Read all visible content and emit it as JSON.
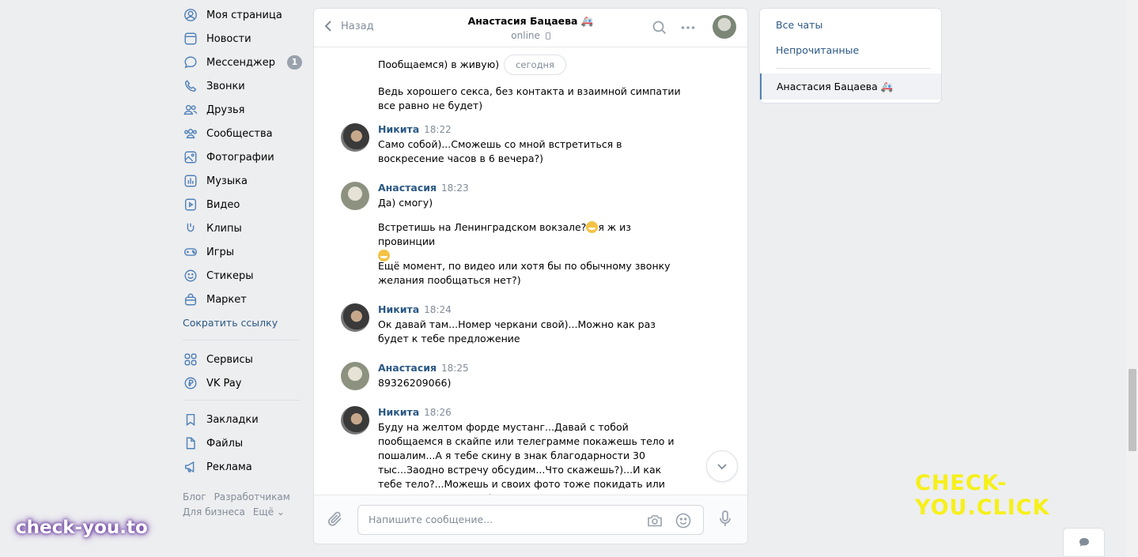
{
  "nav": {
    "items": [
      {
        "label": "Моя страница",
        "icon": "user-circle-icon"
      },
      {
        "label": "Новости",
        "icon": "news-icon"
      },
      {
        "label": "Мессенджер",
        "icon": "message-icon",
        "badge": "1"
      },
      {
        "label": "Звонки",
        "icon": "phone-icon"
      },
      {
        "label": "Друзья",
        "icon": "friends-icon"
      },
      {
        "label": "Сообщества",
        "icon": "communities-icon"
      },
      {
        "label": "Фотографии",
        "icon": "photo-icon"
      },
      {
        "label": "Музыка",
        "icon": "music-icon"
      },
      {
        "label": "Видео",
        "icon": "video-icon"
      },
      {
        "label": "Клипы",
        "icon": "clips-icon"
      },
      {
        "label": "Игры",
        "icon": "gamepad-icon"
      },
      {
        "label": "Стикеры",
        "icon": "sticker-icon"
      },
      {
        "label": "Маркет",
        "icon": "market-bag-icon"
      }
    ],
    "shorten_link": "Сократить ссылку",
    "services": "Сервисы",
    "vkpay": "VK Pay",
    "bookmarks": "Закладки",
    "files": "Файлы",
    "ads": "Реклама",
    "footer": {
      "blog": "Блог",
      "developers": "Разработчикам",
      "business": "Для бизнеса",
      "more": "Ещё ⌄"
    }
  },
  "chat": {
    "back": "Назад",
    "peer_name": "Анастасия Бацаева 🚑",
    "peer_status": "online",
    "date_pill": "сегодня",
    "messages": {
      "m0_line1": "Пообщаемся) в живую)",
      "m0_line2": "Ведь хорошего секса, без контакта и взаимной симпатии все равно не будет)",
      "m1_author": "Никита",
      "m1_time": "18:22",
      "m1_text": "Само собой)...Сможешь со мной встретиться в воскресение часов в 6 вечера?)",
      "m2_author": "Анастасия",
      "m2_time": "18:23",
      "m2_text1": "Да) смогу)",
      "m2_text2a": "Встретишь на Ленинградском вокзале?",
      "m2_text2b": "я ж из провинции",
      "m2_text3": "Ещё момент, по видео или хотя бы по обычному звонку желания пообщаться нет?)",
      "m3_author": "Никита",
      "m3_time": "18:24",
      "m3_text": "Ок давай там...Номер черкани свой)...Можно как раз будет к тебе предложение",
      "m4_author": "Анастасия",
      "m4_time": "18:25",
      "m4_text": "89326209066)",
      "m5_author": "Никита",
      "m5_time": "18:26",
      "m5_text": "Буду на желтом форде мустанг...Давай с тобой пообщаемся в скайпе или телеграмме покажешь тело и пошалим...А я тебе скину в знак благодарности 30 тыс...Заодно встречу обсудим...Что скажешь?)...И как тебе тело?...Можешь и своих фото тоже покидать или видео если не жалко)"
    },
    "composer_placeholder": "Напишите сообщение..."
  },
  "right": {
    "all_chats": "Все чаты",
    "unread": "Непрочитанные",
    "active_chat": "Анастасия Бацаева 🚑"
  },
  "watermarks": {
    "right": "CHECK-YOU.CLICK",
    "left": "check-you.to"
  },
  "colors": {
    "accent": "#5181b8",
    "link": "#2a5885",
    "background": "#edeef0"
  }
}
